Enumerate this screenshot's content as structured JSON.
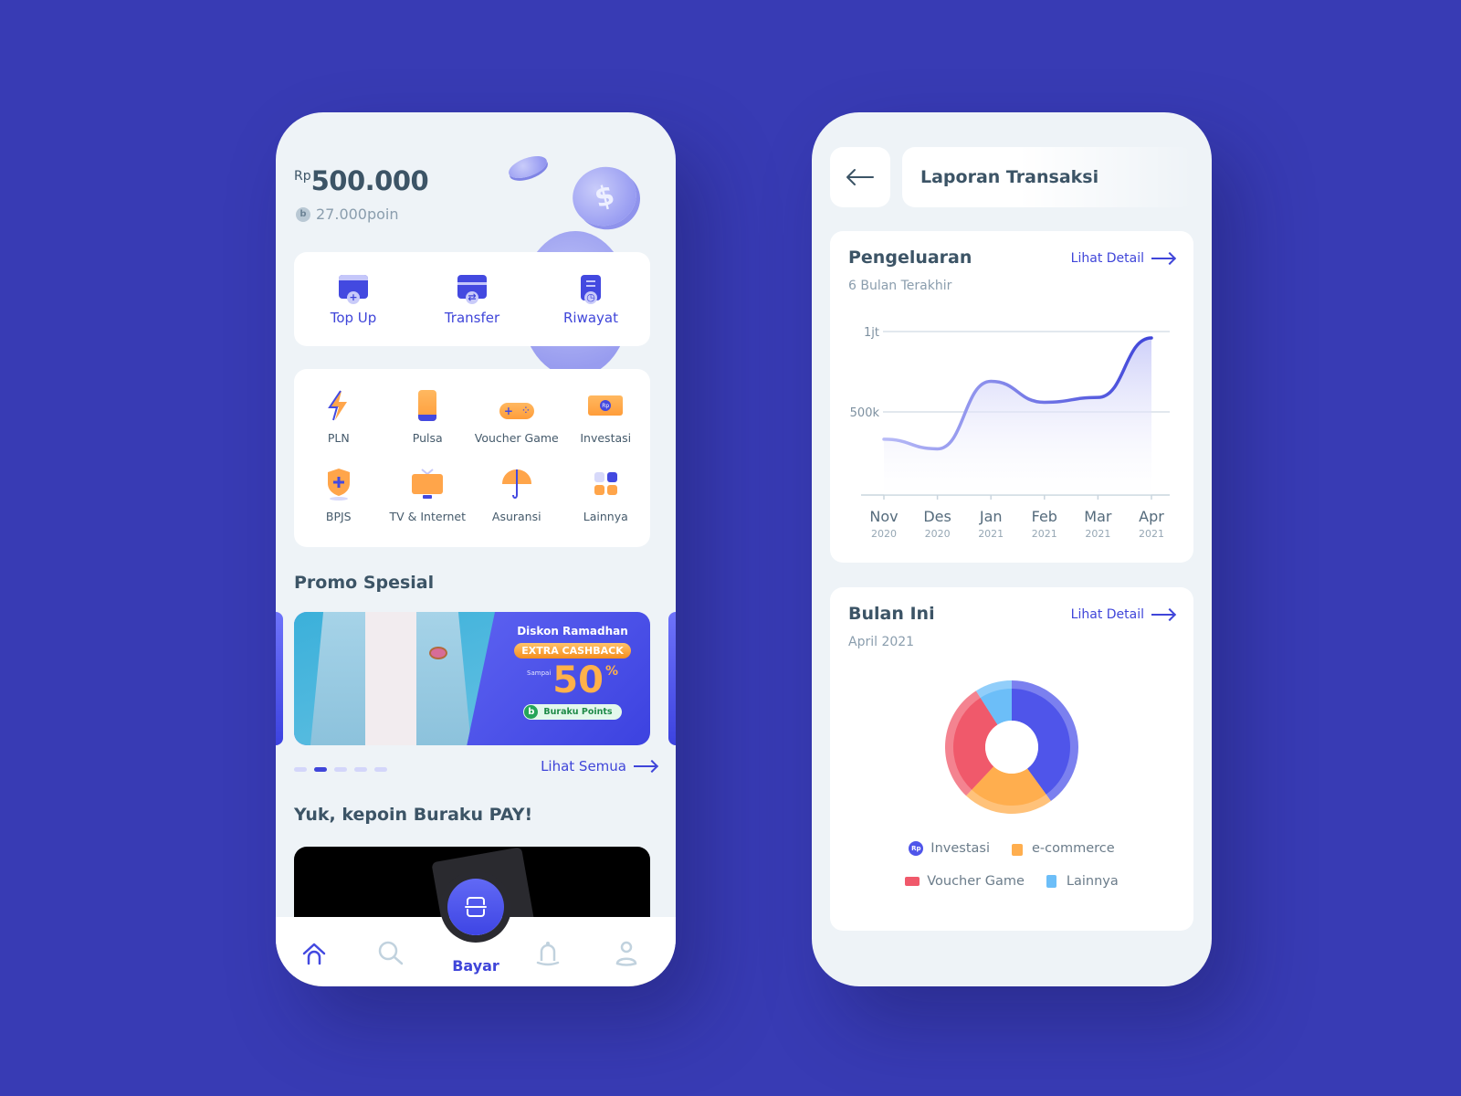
{
  "colors": {
    "background": "#383BB4",
    "accent": "#3F45D9",
    "screen": "#EEF3F7",
    "text_dark": "#3C5466",
    "text_muted": "#8A9DAD",
    "orange": "#FFA54A"
  },
  "home": {
    "balance": {
      "currency": "Rp",
      "amount": "500.000"
    },
    "points": {
      "badge": "b",
      "text": "27.000poin"
    },
    "quick_actions": [
      {
        "label": "Top Up",
        "icon": "wallet-plus-icon"
      },
      {
        "label": "Transfer",
        "icon": "card-transfer-icon"
      },
      {
        "label": "Riwayat",
        "icon": "history-receipt-icon"
      }
    ],
    "services": [
      {
        "label": "PLN",
        "icon": "lightning-icon"
      },
      {
        "label": "Pulsa",
        "icon": "phone-icon"
      },
      {
        "label": "Voucher Game",
        "icon": "gamepad-icon"
      },
      {
        "label": "Investasi",
        "icon": "money-icon"
      },
      {
        "label": "BPJS",
        "icon": "shield-plus-icon"
      },
      {
        "label": "TV & Internet",
        "icon": "tv-icon"
      },
      {
        "label": "Asuransi",
        "icon": "umbrella-icon"
      },
      {
        "label": "Lainnya",
        "icon": "grid-icon"
      }
    ],
    "promo": {
      "title": "Promo Spesial",
      "banner": {
        "headline": "Diskon Ramadhan",
        "pill": "EXTRA CASHBACK",
        "prefix": "Sampai",
        "value": "50",
        "unit": "%",
        "points_badge": "b",
        "points_label": "Buraku Points"
      },
      "pagination": {
        "count": 5,
        "active_index": 1
      },
      "see_all": "Lihat Semua"
    },
    "explore": {
      "title": "Yuk, kepoin Buraku PAY!"
    },
    "tabbar": {
      "items": [
        "home-icon",
        "search-icon",
        "bell-icon",
        "profile-icon"
      ],
      "center_label": "Bayar",
      "active": "home"
    }
  },
  "report": {
    "title": "Laporan Transaksi",
    "expense": {
      "title": "Pengeluaran",
      "subtitle": "6 Bulan Terakhir",
      "link": "Lihat Detail"
    },
    "month": {
      "title": "Bulan Ini",
      "subtitle": "April 2021",
      "link": "Lihat Detail"
    }
  },
  "chart_data": [
    {
      "type": "area",
      "title": "Pengeluaran",
      "subtitle": "6 Bulan Terakhir",
      "categories": [
        "Nov",
        "Des",
        "Jan",
        "Feb",
        "Mar",
        "Apr"
      ],
      "category_years": [
        "2020",
        "2020",
        "2021",
        "2021",
        "2021",
        "2021"
      ],
      "series": [
        {
          "name": "Pengeluaran",
          "values": [
            330000,
            270000,
            690000,
            560000,
            590000,
            960000
          ]
        }
      ],
      "yticks": [
        {
          "value": 500000,
          "label": "500k"
        },
        {
          "value": 1000000,
          "label": "1jt"
        }
      ],
      "ylim": [
        0,
        1000000
      ],
      "grid": true,
      "xlabel": "",
      "ylabel": ""
    },
    {
      "type": "pie",
      "title": "Bulan Ini",
      "subtitle": "April 2021",
      "donut": true,
      "slices": [
        {
          "label": "Investasi",
          "value": 40,
          "color": "#4F55EA",
          "icon": "rp-coin-icon"
        },
        {
          "label": "e-commerce",
          "value": 22,
          "color": "#FFAE4E",
          "icon": "shopping-bag-icon"
        },
        {
          "label": "Voucher Game",
          "value": 29,
          "color": "#F0596B",
          "icon": "ticket-icon"
        },
        {
          "label": "Lainnya",
          "value": 9,
          "color": "#6CBEF8",
          "icon": "card-icon"
        }
      ],
      "legend_placement": "bottom"
    }
  ]
}
